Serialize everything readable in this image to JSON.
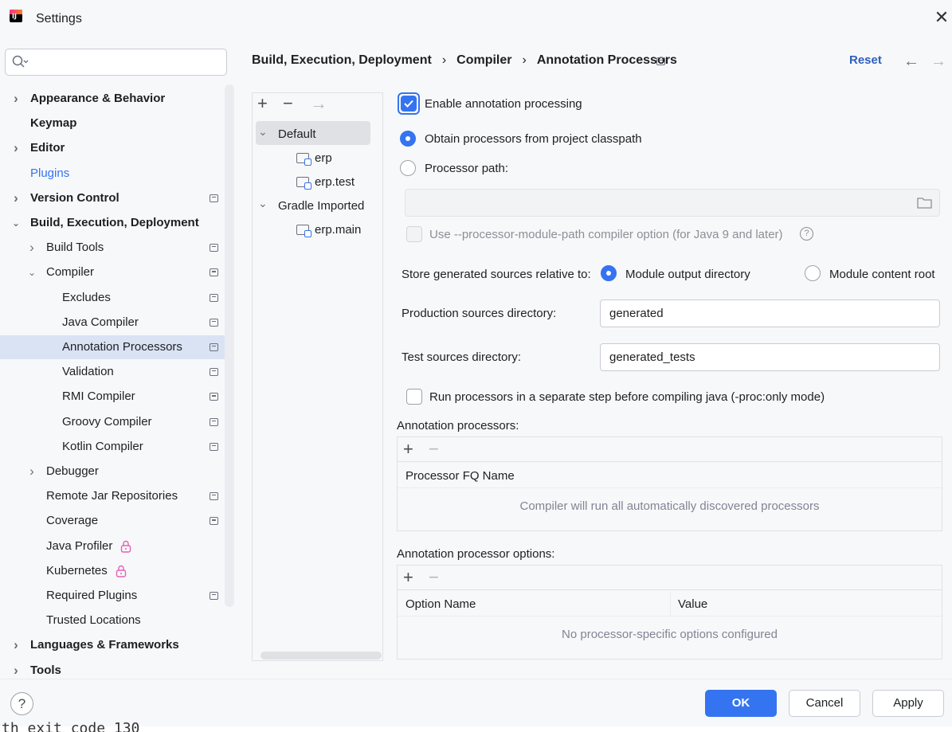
{
  "window": {
    "title": "Settings"
  },
  "search": {
    "placeholder": ""
  },
  "sidebar": {
    "items": [
      {
        "label": "Appearance & Behavior",
        "level": 0,
        "expandable": true,
        "expanded": false,
        "bold": true
      },
      {
        "label": "Keymap",
        "level": 0,
        "expandable": false,
        "bold": true
      },
      {
        "label": "Editor",
        "level": 0,
        "expandable": true,
        "expanded": false,
        "bold": true
      },
      {
        "label": "Plugins",
        "level": 0,
        "expandable": false,
        "link": true
      },
      {
        "label": "Version Control",
        "level": 0,
        "expandable": true,
        "expanded": false,
        "bold": true,
        "project_icon": true
      },
      {
        "label": "Build, Execution, Deployment",
        "level": 0,
        "expandable": true,
        "expanded": true,
        "bold": true
      },
      {
        "label": "Build Tools",
        "level": 1,
        "expandable": true,
        "expanded": false,
        "project_icon": true
      },
      {
        "label": "Compiler",
        "level": 1,
        "expandable": true,
        "expanded": true,
        "project_icon": true
      },
      {
        "label": "Excludes",
        "level": 2,
        "project_icon": true
      },
      {
        "label": "Java Compiler",
        "level": 2,
        "project_icon": true
      },
      {
        "label": "Annotation Processors",
        "level": 2,
        "project_icon": true,
        "selected": true
      },
      {
        "label": "Validation",
        "level": 2,
        "project_icon": true
      },
      {
        "label": "RMI Compiler",
        "level": 2,
        "project_icon": true
      },
      {
        "label": "Groovy Compiler",
        "level": 2,
        "project_icon": true
      },
      {
        "label": "Kotlin Compiler",
        "level": 2,
        "project_icon": true
      },
      {
        "label": "Debugger",
        "level": 1,
        "expandable": true,
        "expanded": false
      },
      {
        "label": "Remote Jar Repositories",
        "level": 1,
        "project_icon": true
      },
      {
        "label": "Coverage",
        "level": 1,
        "project_icon": true
      },
      {
        "label": "Java Profiler",
        "level": 1,
        "lock": true
      },
      {
        "label": "Kubernetes",
        "level": 1,
        "lock": true
      },
      {
        "label": "Required Plugins",
        "level": 1,
        "project_icon": true
      },
      {
        "label": "Trusted Locations",
        "level": 1
      },
      {
        "label": "Languages & Frameworks",
        "level": 0,
        "expandable": true,
        "expanded": false,
        "bold": true
      },
      {
        "label": "Tools",
        "level": 0,
        "expandable": true,
        "expanded": false,
        "bold": true
      }
    ]
  },
  "breadcrumb": {
    "part1": "Build, Execution, Deployment",
    "part2": "Compiler",
    "part3": "Annotation Processors",
    "sep": "›"
  },
  "header": {
    "reset_label": "Reset"
  },
  "modules": {
    "items": [
      {
        "label": "Default",
        "type": "profile",
        "expanded": true,
        "selected": true
      },
      {
        "label": "erp",
        "type": "module"
      },
      {
        "label": "erp.test",
        "type": "module"
      },
      {
        "label": "Gradle Imported",
        "type": "profile",
        "expanded": true
      },
      {
        "label": "erp.main",
        "type": "module"
      }
    ]
  },
  "form": {
    "enable_processing": {
      "label": "Enable annotation processing",
      "checked": true
    },
    "obtain_classpath": {
      "label": "Obtain processors from project classpath",
      "selected": true
    },
    "processor_path": {
      "label": "Processor path:",
      "selected": false,
      "value": ""
    },
    "module_path_option": {
      "label": "Use --processor-module-path compiler option (for Java 9 and later)",
      "checked": false,
      "disabled": true
    },
    "store_relative": {
      "label": "Store generated sources relative to:",
      "option1": "Module output directory",
      "option2": "Module content root",
      "selected": "option1"
    },
    "production_dir": {
      "label": "Production sources directory:",
      "value": "generated"
    },
    "test_dir": {
      "label": "Test sources directory:",
      "value": "generated_tests"
    },
    "run_separate": {
      "label": "Run processors in a separate step before compiling java (-proc:only mode)",
      "checked": false
    }
  },
  "processors_table": {
    "title": "Annotation processors:",
    "column": "Processor FQ Name",
    "empty_text": "Compiler will run all automatically discovered processors"
  },
  "options_table": {
    "title": "Annotation processor options:",
    "col1": "Option Name",
    "col2": "Value",
    "empty_text": "No processor-specific options configured"
  },
  "footer": {
    "help": "?",
    "ok": "OK",
    "cancel": "Cancel",
    "apply": "Apply"
  },
  "background": {
    "terminal_text": "th exit code 130"
  },
  "colors": {
    "accent": "#3574f0",
    "selection": "#dae3f4",
    "link": "#2e5fbd"
  }
}
